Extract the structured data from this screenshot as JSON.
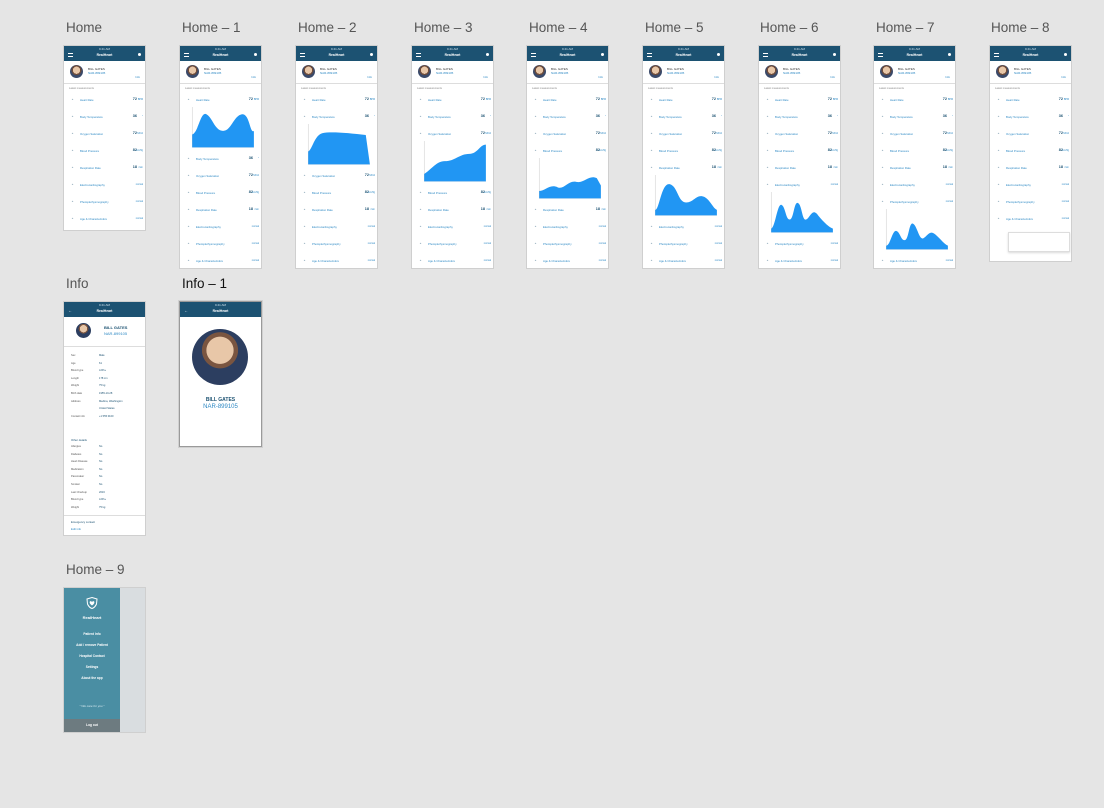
{
  "app": {
    "name": "RealHeart",
    "status_bar": "9:41 AM",
    "patient_name": "BILL GATES",
    "patient_id": "NAR-899105",
    "info_button": "Info",
    "section_title": "Latest measurements"
  },
  "boards": [
    {
      "label": "Home"
    },
    {
      "label": "Home – 1"
    },
    {
      "label": "Home – 2"
    },
    {
      "label": "Home – 3"
    },
    {
      "label": "Home – 4"
    },
    {
      "label": "Home – 5"
    },
    {
      "label": "Home – 6"
    },
    {
      "label": "Home – 7"
    },
    {
      "label": "Home – 8"
    },
    {
      "label": "Info"
    },
    {
      "label": "Info – 1"
    },
    {
      "label": "Home – 9"
    }
  ],
  "metrics": [
    {
      "name": "Heart Rate",
      "value": "72",
      "unit": "BPM",
      "icon": "heart-icon"
    },
    {
      "name": "Body Temperature",
      "value": "36",
      "unit": "°",
      "icon": "thermometer-icon"
    },
    {
      "name": "Oxygen Saturation",
      "value": "72",
      "unit": "SPo2",
      "icon": "oxygen-icon"
    },
    {
      "name": "Blood Pressure",
      "value": "82",
      "unit": "mmHg",
      "icon": "pressure-icon"
    },
    {
      "name": "Respiration Rate",
      "value": "18",
      "unit": "/min",
      "icon": "lungs-icon"
    },
    {
      "name": "Electrocardiography",
      "value": "",
      "unit": "normal",
      "icon": "ecg-icon"
    },
    {
      "name": "Photoplethysmography",
      "value": "",
      "unit": "normal",
      "icon": "ppg-icon"
    },
    {
      "name": "Age & Characteristics",
      "value": "",
      "unit": "normal",
      "icon": "person-icon"
    }
  ],
  "info": {
    "back": "←",
    "fields": [
      {
        "k": "Sex",
        "v": "Male"
      },
      {
        "k": "Age",
        "v": "61"
      },
      {
        "k": "Blood type",
        "v": "A Rh+"
      },
      {
        "k": "Length",
        "v": "178 cm"
      },
      {
        "k": "Weight",
        "v": "75 kg"
      },
      {
        "k": "Birth date",
        "v": "1955-10-28"
      },
      {
        "k": "Address",
        "v": "Medina, Washington"
      },
      {
        "k": "",
        "v": "United States"
      },
      {
        "k": "Contact info",
        "v": "+1 555 0100"
      }
    ],
    "section2": "Other details",
    "fields2": [
      {
        "k": "Allergies",
        "v": "No"
      },
      {
        "k": "Diabetes",
        "v": "No"
      },
      {
        "k": "Heart Disease",
        "v": "No"
      },
      {
        "k": "Medication",
        "v": "No"
      },
      {
        "k": "Pacemaker",
        "v": "No"
      },
      {
        "k": "Smoker",
        "v": "No"
      },
      {
        "k": "Last Checkup",
        "v": "2016"
      },
      {
        "k": "Blood type",
        "v": "A Rh+"
      },
      {
        "k": "Weight",
        "v": "75 kg"
      }
    ],
    "footer1": "Emergency contact",
    "footer2": "Edit info"
  },
  "menu": {
    "brand": "RealHeart",
    "items": [
      "Patient Info",
      "Add / remove Patient",
      "Hospital Contact",
      "Settings",
      "About the app"
    ],
    "quote": "\" We care for you \"",
    "logout": "Log out"
  }
}
